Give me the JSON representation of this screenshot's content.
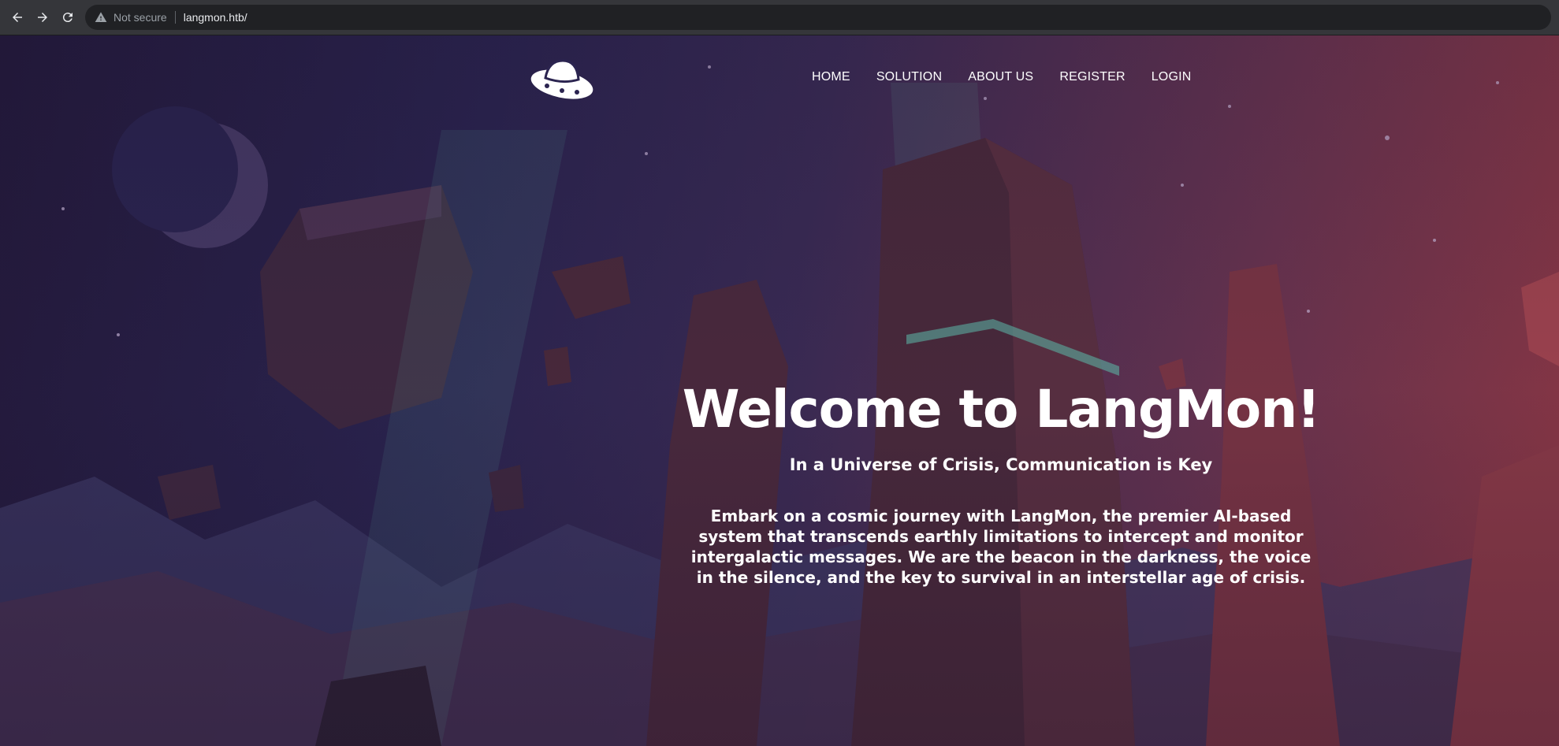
{
  "browser": {
    "security_label": "Not secure",
    "url": "langmon.htb/"
  },
  "nav": {
    "items": [
      {
        "label": "HOME"
      },
      {
        "label": "SOLUTION"
      },
      {
        "label": "ABOUT US"
      },
      {
        "label": "REGISTER"
      },
      {
        "label": "LOGIN"
      }
    ]
  },
  "hero": {
    "title": "Welcome to LangMon!",
    "subtitle": "In a Universe of Crisis, Communication is Key",
    "description": "Embark on a cosmic journey with LangMon, the premier AI-based system that transcends earthly limitations to intercept and monitor intergalactic messages. We are the beacon in the darkness, the voice in the silence, and the key to survival in an interstellar age of crisis."
  },
  "colors": {
    "chrome_bg": "#35363a",
    "page_gradient_left": "#241a3c",
    "page_gradient_right": "#8e3845",
    "text": "#ffffff"
  },
  "icons": [
    "back-arrow-icon",
    "forward-arrow-icon",
    "reload-icon",
    "warning-icon",
    "ufo-logo-icon"
  ]
}
